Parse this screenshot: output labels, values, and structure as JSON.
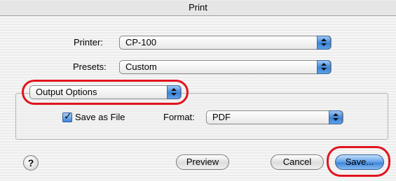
{
  "window": {
    "title": "Print"
  },
  "printer": {
    "label": "Printer:",
    "value": "CP-100"
  },
  "presets": {
    "label": "Presets:",
    "value": "Custom"
  },
  "panel_select": {
    "value": "Output Options"
  },
  "output_options": {
    "save_as_file": {
      "label": "Save as File",
      "checked": true
    },
    "format": {
      "label": "Format:",
      "value": "PDF"
    }
  },
  "buttons": {
    "help": "?",
    "preview": "Preview",
    "cancel": "Cancel",
    "save": "Save..."
  },
  "annotation_color": "#e0141e"
}
